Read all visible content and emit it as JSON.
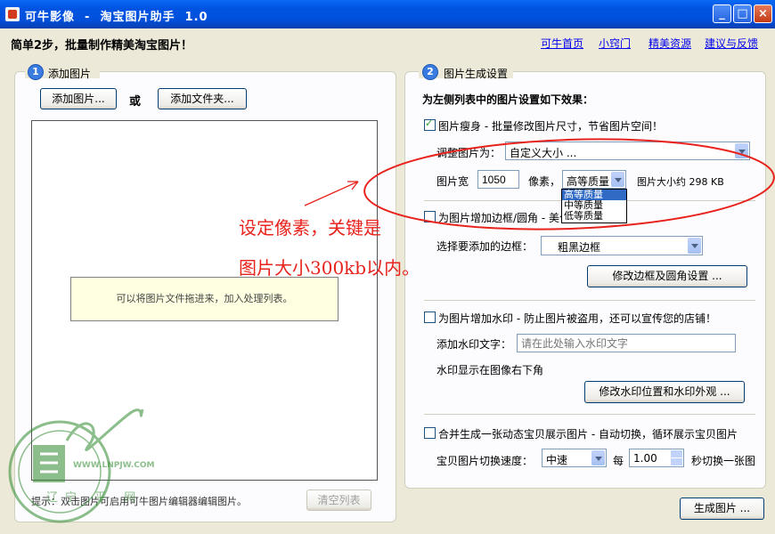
{
  "window": {
    "title": "可牛影像  -  淘宝图片助手  1.0",
    "min": "_",
    "max": "□",
    "close": "×"
  },
  "header": {
    "title": "简单2步，批量制作精美淘宝图片！",
    "links": [
      "可牛首页",
      "小窍门",
      "精美资源",
      "建议与反馈"
    ]
  },
  "left": {
    "step": "1",
    "group_title": "添加图片",
    "add_image": "添加图片...",
    "or": "或",
    "add_folder": "添加文件夹...",
    "hint": "可以将图片文件拖进来，加入处理列表。",
    "tip": "提示：双击图片可启用可牛图片编辑器编辑图片。",
    "clear": "清空列表"
  },
  "right": {
    "step": "2",
    "group_title": "图片生成设置",
    "intro": "为左侧列表中的图片设置如下效果：",
    "slim": {
      "label": "图片瘦身 - 批量修改图片尺寸，节省图片空间！",
      "checked": true,
      "adjust_label": "调整图片为：",
      "adjust_value": "自定义大小 ...",
      "width_label": "图片宽",
      "width_value": "1050",
      "unit": "像素，",
      "quality_value": "高等质量",
      "quality_options": [
        "高等质量",
        "中等质量",
        "低等质量"
      ],
      "size_text": "图片大小约 298 KB"
    },
    "border": {
      "label": "为图片增加边框/圆角 - 美化图片",
      "checked": false,
      "select_label": "选择要添加的边框：",
      "select_value": "粗黑边框",
      "button": "修改边框及圆角设置 ..."
    },
    "watermark": {
      "label": "为图片增加水印 - 防止图片被盗用，还可以宣传您的店铺！",
      "checked": false,
      "text_label": "添加水印文字：",
      "text_placeholder": "请在此处输入水印文字",
      "position_text": "水印显示在图像右下角",
      "button": "修改水印位置和水印外观 ..."
    },
    "gif": {
      "label": "合并生成一张动态宝贝展示图片 - 自动切换，循环展示宝贝图片",
      "checked": false,
      "speed_label": "宝贝图片切换速度：",
      "speed_value": "中速",
      "every": "每",
      "seconds_value": "1.00",
      "seconds_label": "秒切换一张图"
    },
    "generate": "生成图片 ..."
  },
  "annotation": {
    "line1": "设定像素，关键是",
    "line2": "图片大小300kb以内。",
    "color": "#e8221c"
  },
  "watermark_site": {
    "url": "WWW.LNPJW.COM",
    "text": "辽宁 平 网"
  }
}
